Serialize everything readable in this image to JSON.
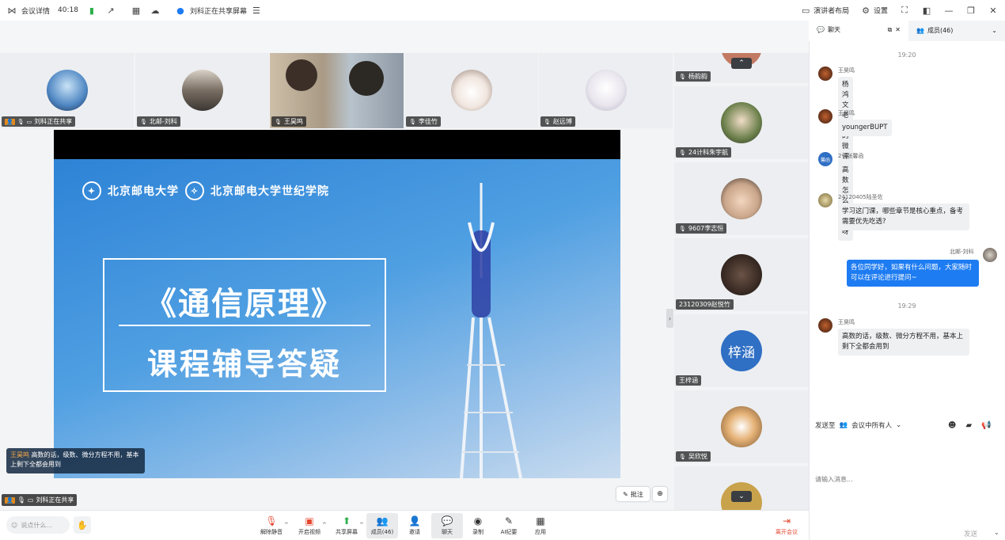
{
  "topbar": {
    "meeting_details": "会议详情",
    "timer": "40:18",
    "share_status": "刘科正在共享屏幕",
    "presenter_layout": "演讲者布局",
    "settings": "设置"
  },
  "tiles": [
    {
      "name": "刘科正在共享"
    },
    {
      "name": "北邮-刘科"
    },
    {
      "name": "王昊鸣"
    },
    {
      "name": "李佳竹"
    },
    {
      "name": "赵远博"
    }
  ],
  "slide": {
    "university": "北京邮电大学",
    "college": "北京邮电大学世纪学院",
    "title": "《通信原理》",
    "subtitle": "课程辅导答疑"
  },
  "caption": {
    "speaker": "王昊鸣",
    "text": "高数的话，级数、微分方程不用，基本上剩下全都会用到"
  },
  "presenter_tag": "刘科正在共享",
  "annotate_label": "批注",
  "side_participants": [
    {
      "name": "杨韵韵"
    },
    {
      "name": "24计科朱宇航"
    },
    {
      "name": "9607李志恒"
    },
    {
      "name": "23120309赵悦竹"
    },
    {
      "name": "王梓涵",
      "initials": "梓涵"
    },
    {
      "name": "吴欣悦"
    }
  ],
  "toolbar": {
    "say_placeholder": "说点什么...",
    "mute": "解除静音",
    "video": "开启视频",
    "share": "共享屏幕",
    "members": "成员(46)",
    "invite": "邀请",
    "chat": "聊天",
    "record": "录制",
    "ai": "AI纪要",
    "apps": "应用",
    "leave": "离开会议"
  },
  "chat": {
    "tab_chat": "聊天",
    "tab_members": "成员(46)",
    "messages": [
      {
        "time": "19:20"
      },
      {
        "sender": "王昊鸣",
        "text": "杨鸿文老师的微课"
      },
      {
        "sender": "王昊鸣",
        "text": "youngerBUPT"
      },
      {
        "sender": "2-4张馨函",
        "avatar_text": "馨函",
        "text": "高数怎么学习呀"
      },
      {
        "sender": "24120405陆圣佐",
        "text": "学习这门课，哪些章节是核心重点，备考需要优先吃透?"
      },
      {
        "sender": "北邮-刘科",
        "text": "各位同学好，如果有什么问题，大家随时可以在评论进行提问~"
      },
      {
        "time": "19:29"
      },
      {
        "sender": "王昊鸣",
        "text": "高数的话，级数、微分方程不用，基本上剩下全都会用到"
      }
    ],
    "send_to_label": "发送至",
    "send_to_value": "会议中所有人",
    "input_placeholder": "请输入消息...",
    "send": "发送"
  },
  "colors": {
    "accent": "#1e7cf2",
    "leave": "#e5472f",
    "slide_blue": "#2e83d6"
  }
}
